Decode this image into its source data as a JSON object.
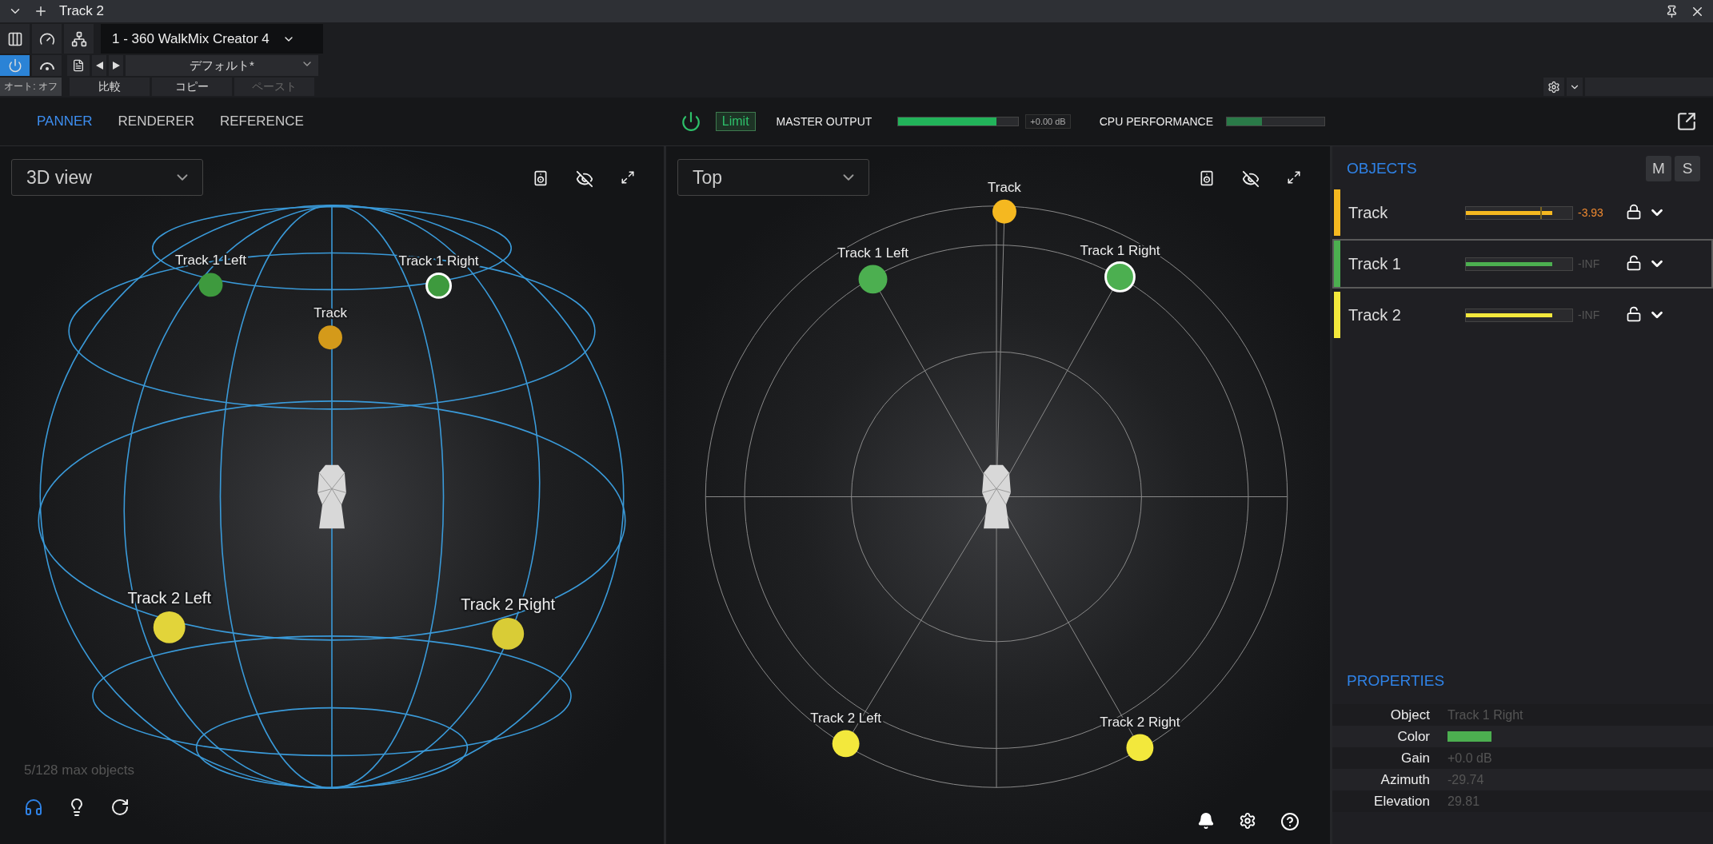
{
  "title_bar": {
    "title": "Track 2"
  },
  "toolbar": {
    "preset": "1 - 360 WalkMix Creator 4",
    "power_on": true,
    "automation": "オート: オフ",
    "preset_name": "デフォルト*",
    "buttons": [
      {
        "label": "比較",
        "disabled": false
      },
      {
        "label": "コピー",
        "disabled": false
      },
      {
        "label": "ペースト",
        "disabled": true
      }
    ]
  },
  "tabs": [
    {
      "label": "PANNER",
      "selected": true
    },
    {
      "label": "RENDERER",
      "selected": false
    },
    {
      "label": "REFERENCE",
      "selected": false
    }
  ],
  "header": {
    "limit": "Limit",
    "master_output": {
      "label": "MASTER OUTPUT",
      "level": 0.82,
      "reading": "+0.00 dB"
    },
    "cpu": {
      "label": "CPU PERFORMANCE",
      "level": 0.36
    }
  },
  "view_3d": {
    "view": "3D view",
    "footer": "5/128 max objects",
    "markers": [
      {
        "label": "Track 1 Left",
        "color": "#3e9a3e",
        "selected": false
      },
      {
        "label": "Track 1 Right",
        "color": "#3e9a3e",
        "selected": true
      },
      {
        "label": "Track",
        "color": "#d49a1a",
        "selected": false
      },
      {
        "label": "Track 2 Left",
        "color": "#e2d43a",
        "selected": false
      },
      {
        "label": "Track 2 Right",
        "color": "#d9cc36",
        "selected": false
      }
    ]
  },
  "view_top": {
    "view": "Top",
    "markers": [
      {
        "label": "Track",
        "color": "#f5b820",
        "selected": false
      },
      {
        "label": "Track 1 Left",
        "color": "#4caf50",
        "selected": false
      },
      {
        "label": "Track 1 Right",
        "color": "#4caf50",
        "selected": true
      },
      {
        "label": "Track 2 Left",
        "color": "#f3e83c",
        "selected": false
      },
      {
        "label": "Track 2 Right",
        "color": "#f3e83c",
        "selected": false
      }
    ]
  },
  "objects": {
    "title": "OBJECTS",
    "buttons": [
      "M",
      "S"
    ],
    "items": [
      {
        "name": "Track",
        "color": "#f5b820",
        "level": 0.81,
        "reading": "-3.93",
        "warning": true,
        "locked": true,
        "selected": false
      },
      {
        "name": "Track 1",
        "color": "#4caf50",
        "level": 0.81,
        "reading": "-INF",
        "warning": false,
        "locked": false,
        "selected": true
      },
      {
        "name": "Track 2",
        "color": "#f3e83c",
        "level": 0.81,
        "reading": "-INF",
        "warning": false,
        "locked": false,
        "selected": false
      }
    ]
  },
  "properties": {
    "title": "PROPERTIES",
    "rows": [
      {
        "label": "Object",
        "kind": "text",
        "value": "Track 1 Right"
      },
      {
        "label": "Color",
        "kind": "swatch",
        "color": "#4caf50"
      },
      {
        "label": "Gain",
        "kind": "text",
        "value": "+0.0 dB"
      },
      {
        "label": "Azimuth",
        "kind": "text",
        "value": "-29.74"
      },
      {
        "label": "Elevation",
        "kind": "text",
        "value": "29.81"
      }
    ]
  }
}
